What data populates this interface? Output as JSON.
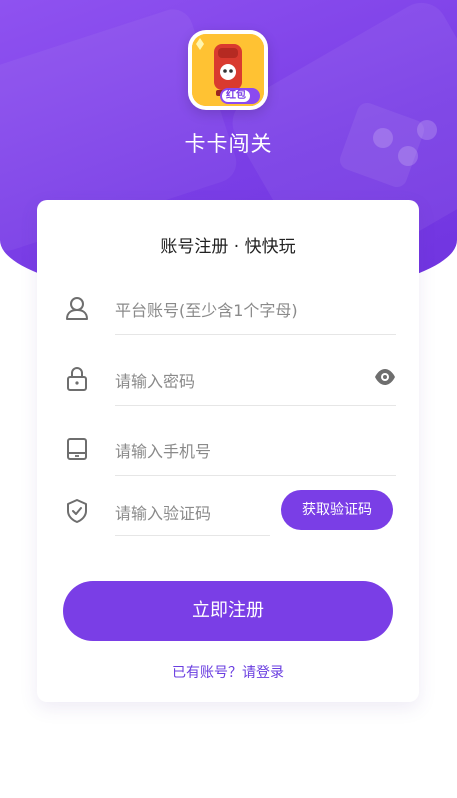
{
  "app": {
    "title": "卡卡闯关",
    "icon_badge": "红包"
  },
  "form": {
    "title": "账号注册 · 快快玩",
    "account_placeholder": "平台账号(至少含1个字母)",
    "password_placeholder": "请输入密码",
    "phone_placeholder": "请输入手机号",
    "code_placeholder": "请输入验证码",
    "get_code_label": "获取验证码",
    "register_label": "立即注册",
    "login_link": "已有账号？请登录"
  },
  "colors": {
    "accent": "#7a3ee6",
    "hero_gradient": [
      "#8f52f0",
      "#6f33df"
    ]
  },
  "icons": {
    "account": "user-icon",
    "password": "lock-icon",
    "phone": "phone-icon",
    "code": "shield-check-icon",
    "toggle_password": "eye-icon"
  }
}
